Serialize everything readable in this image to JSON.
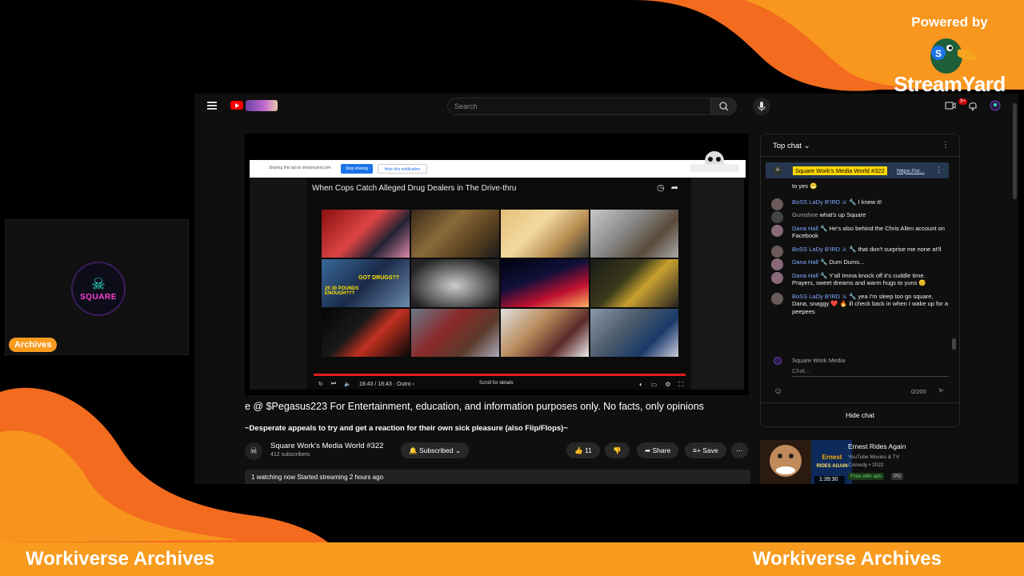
{
  "colors": {
    "accent_orange": "#f89b1e",
    "accent_orange_deep": "#f36b1e",
    "youtube_bg": "#0f0f0f",
    "chat_author": "#7fa8ff",
    "pinned_highlight": "#ffd600",
    "progress_red": "#e02020"
  },
  "branding": {
    "powered_by": "Powered by",
    "streamyard": "StreamYard"
  },
  "cam_tile": {
    "badge": "Archives",
    "logo_text": "SQUARE"
  },
  "youtube": {
    "search_placeholder": "Search",
    "notification_count": "9+",
    "video": {
      "share_bar_text": "Sharing this tab to streamyard.com",
      "stop_sharing": "Stop sharing",
      "hide": "Hide this notification",
      "inner_title": "When Cops Catch Alleged Drug Dealers in The Drive-thru",
      "time": "18:43 / 18:43 · Outro ›",
      "scroll_hint": "Scroll for details",
      "progress": 1.0,
      "thumb_captions": [
        "GOT DRUGS??",
        "25 30 POUNDS ENOUGH???"
      ]
    },
    "marquee": "e @ $Pegasus223 For Entertainment, education, and information purposes only. No facts, only opinions",
    "description": "~Desperate appeals to try and get a reaction for their own sick pleasure (also Flip/Flops)~",
    "channel": {
      "name": "Square Work's Media World #322",
      "subscribers": "412 subscribers",
      "subscribed_label": "Subscribed",
      "likes": "11",
      "share_label": "Share",
      "save_label": "Save"
    },
    "meta": {
      "watching": "1",
      "watching_label": "watching now",
      "started": "Started streaming 2 hours ago"
    },
    "chat": {
      "header": "Top chat",
      "pinned_name": "Square Work's Media World #322",
      "pinned_link": "https://st...",
      "messages": [
        {
          "author": "",
          "text": "to yes 😬"
        },
        {
          "author": "BoSS LaDy B'IRD ⚔ 🔧",
          "text": "I knew it!"
        },
        {
          "author": "Gumshoe",
          "text": "what's up Square",
          "plain": true
        },
        {
          "author": "Dana Hall 🔧",
          "text": "He's also behind the Chris Allen account on Facebook"
        },
        {
          "author": "BoSS LaDy B'IRD ⚔ 🔧",
          "text": "that don't surprise me none at'll"
        },
        {
          "author": "Dana Hall 🔧",
          "text": "Dum Dums..."
        },
        {
          "author": "Dana Hall 🔧",
          "text": "Y'all Imma knock off it's cuddle time. Prayers, sweet dreams and warm hugs to yuns 😊"
        },
        {
          "author": "BoSS LaDy B'IRD ⚔ 🔧",
          "text": "yea I'm sleep too gn square, Dana, snaggy ❤️ 🔥 ill check back in when I wake up for a peepees"
        }
      ],
      "input_user": "Square Work Media",
      "input_placeholder": "Chat...",
      "char_count": "0/200",
      "hide_chat": "Hide chat"
    },
    "recommendation": {
      "title": "Ernest Rides Again",
      "source": "YouTube Movies & TV",
      "genre": "Comedy • 2022",
      "free": "Free with ads",
      "rating": "PG",
      "duration": "1:39:30",
      "thumb_text": "Ernest Rides Again"
    }
  },
  "banner": {
    "left": "Workiverse Archives",
    "right": "Workiverse Archives"
  }
}
